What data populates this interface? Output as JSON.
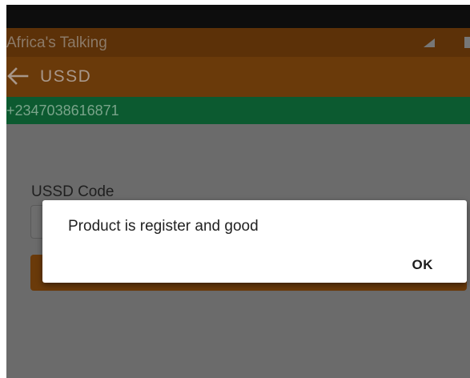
{
  "status_bar": {
    "title": "Africa's Talking",
    "icons": [
      "signal-icon",
      "battery-icon"
    ]
  },
  "toolbar": {
    "back_icon": "arrow-left-icon",
    "title": "USSD"
  },
  "phone_bar": {
    "number": "+2347038616871"
  },
  "form": {
    "ussd_label": "USSD Code",
    "ussd_value": ""
  },
  "dialog": {
    "message": "Product is register and good",
    "ok_label": "OK"
  },
  "colors": {
    "toolbar": "#6a3a0a",
    "phone_bar": "#0c5a30",
    "dialog_background": "#ffffff"
  }
}
